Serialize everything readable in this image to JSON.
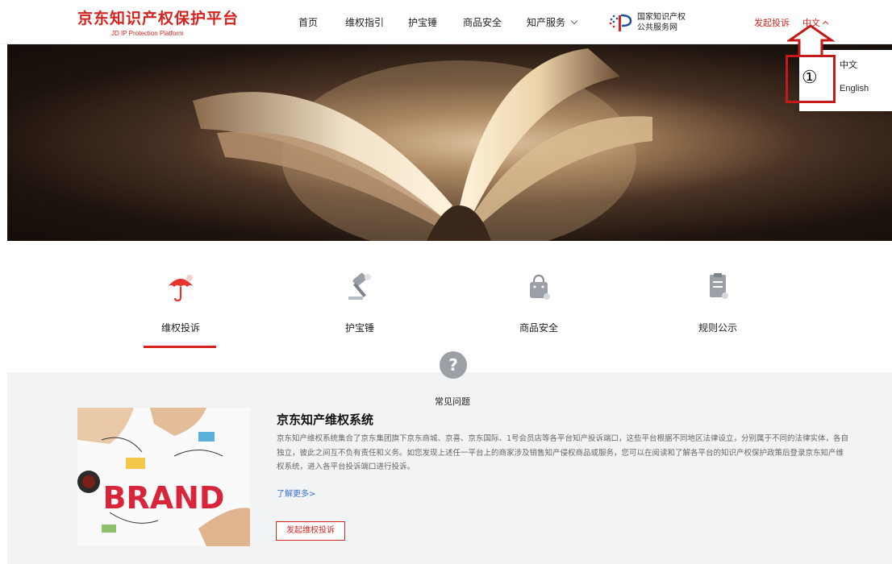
{
  "header": {
    "logo_cn": "京东知识产权保护平台",
    "logo_en": "JD IP Protection Platform",
    "nav": [
      "首页",
      "维权指引",
      "护宝锤",
      "商品安全",
      "知产服务"
    ],
    "gov_line1": "国家知识产权",
    "gov_line2": "公共服务网",
    "complain": "发起投诉",
    "lang": "中文"
  },
  "dropdown": {
    "zh": "中文",
    "en": "English"
  },
  "annotation": {
    "num": "①"
  },
  "features": [
    {
      "label": "维权投诉",
      "icon": "umbrella-icon"
    },
    {
      "label": "护宝锤",
      "icon": "hammer-icon"
    },
    {
      "label": "商品安全",
      "icon": "bag-icon"
    },
    {
      "label": "规则公示",
      "icon": "clipboard-icon"
    }
  ],
  "faq": {
    "icon": "?",
    "title": "常见问题",
    "sys_title": "京东知产维权系统",
    "desc": "京东知产维权系统集合了京东集团旗下京东商城、京喜、京东国际、1号会员店等各平台知产投诉端口，这些平台根据不同地区法律设立，分别属于不同的法律实体，各自独立，彼此之间互不负有责任和义务。如您发现上述任一平台上的商家涉及销售知产侵权商品或服务，您可以在阅读和了解各平台的知识产权保护政策后登录京东知产维权系统，进入各平台投诉端口进行投诉。",
    "more": "了解更多>",
    "button": "发起维权投诉",
    "brand_word": "BRAND"
  },
  "colors": {
    "brand": "#d4241f",
    "link": "#3b6fd0",
    "band": "#f2f3f5"
  }
}
